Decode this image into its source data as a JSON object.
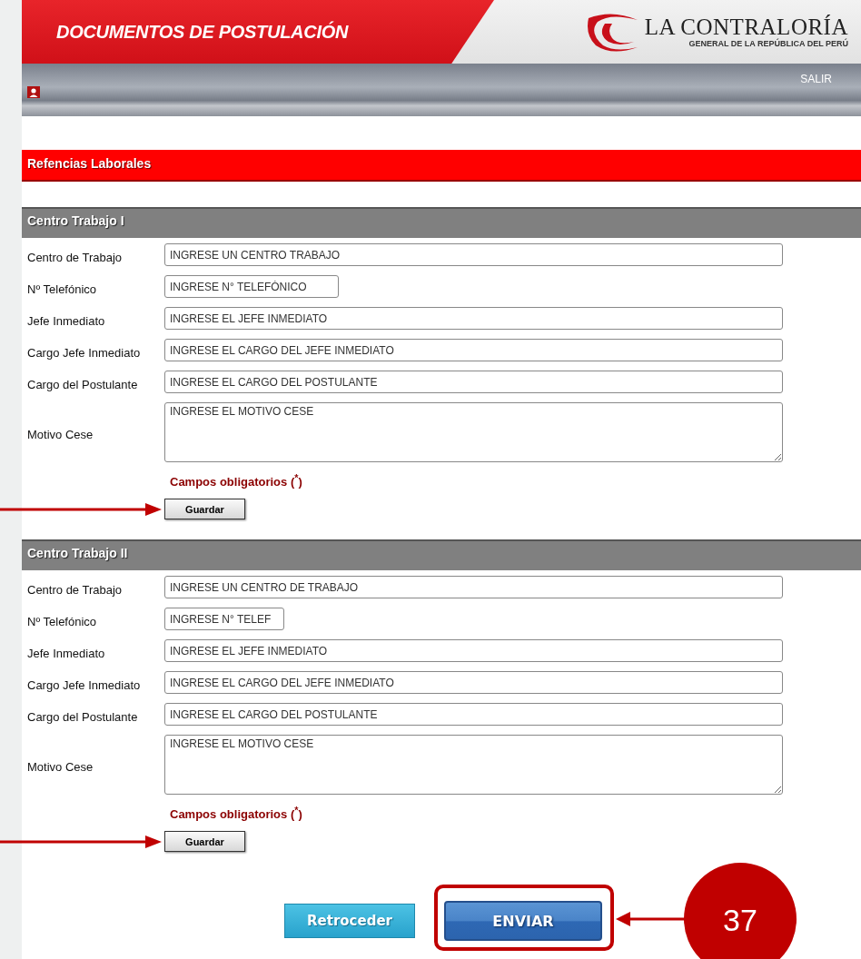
{
  "header": {
    "title": "DOCUMENTOS DE POSTULACIÓN",
    "logo_title": "LA CONTRALORÍA",
    "logo_subtitle": "GENERAL DE LA REPÚBLICA DEL PERÚ"
  },
  "toolbar": {
    "logout": "SALIR"
  },
  "section_title": "Refencias Laborales",
  "groups": [
    {
      "title": "Centro Trabajo I",
      "fields": [
        {
          "label": "Centro de Trabajo",
          "placeholder": "INGRESE UN CENTRO TRABAJO",
          "kind": "text"
        },
        {
          "label": "Nº Telefónico",
          "placeholder": "INGRESE N° TELEFÓNICO",
          "kind": "short"
        },
        {
          "label": "Jefe Inmediato",
          "placeholder": "INGRESE EL JEFE INMEDIATO",
          "kind": "text"
        },
        {
          "label": "Cargo Jefe Inmediato",
          "placeholder": "INGRESE EL CARGO DEL JEFE INMEDIATO",
          "kind": "text"
        },
        {
          "label": "Cargo del Postulante",
          "placeholder": "INGRESE EL CARGO DEL POSTULANTE",
          "kind": "text"
        },
        {
          "label": "Motivo Cese",
          "placeholder": "INGRESE EL MOTIVO CESE",
          "kind": "multiline"
        }
      ],
      "required_note": "Campos obligatorios ($^{*}$)",
      "save_button": "Guardar"
    },
    {
      "title": "Centro Trabajo II",
      "fields": [
        {
          "label": "Centro de Trabajo",
          "placeholder": "INGRESE UN CENTRO DE TRABAJO",
          "kind": "text"
        },
        {
          "label": "Nº Telefónico",
          "placeholder": "INGRESE N° TELEF",
          "kind": "narrow"
        },
        {
          "label": "Jefe Inmediato",
          "placeholder": "INGRESE EL JEFE INMEDIATO",
          "kind": "text"
        },
        {
          "label": "Cargo Jefe Inmediato",
          "placeholder": "INGRESE EL CARGO DEL JEFE INMEDIATO",
          "kind": "text"
        },
        {
          "label": "Cargo del Postulante",
          "placeholder": "INGRESE EL CARGO DEL POSTULANTE",
          "kind": "text"
        },
        {
          "label": "Motivo Cese",
          "placeholder": "INGRESE EL MOTIVO CESE",
          "kind": "multiline"
        }
      ],
      "required_note": "Campos obligatorios ($^{*}$)",
      "save_button": "Guardar"
    }
  ],
  "buttons": {
    "back": "Retroceder",
    "submit": "ENVIAR"
  },
  "step_badge": "37"
}
